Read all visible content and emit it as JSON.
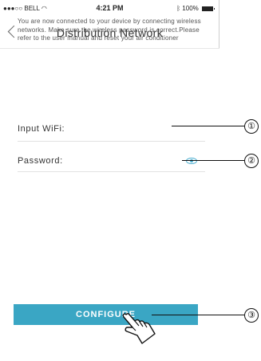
{
  "status_bar": {
    "carrier": "●●●○○ BELL",
    "time": "4:21 PM",
    "battery": "100%"
  },
  "nav": {
    "title": "Distribution Network"
  },
  "intro_text": "You are now connected to your device by connecting wireless networks. Make sure the wireless password is correct.Please refer to the user manual and reset your air conditioner",
  "fields": {
    "wifi_label": "Input WiFi:",
    "password_label": "Password:"
  },
  "configure_label": "CONFIGURE",
  "callouts": [
    "①",
    "②",
    "③"
  ],
  "colors": {
    "accent": "#3aa6c4"
  },
  "icons": {
    "back": "chevron-left-icon",
    "eye": "eye-icon",
    "hand": "hand-pointer-icon",
    "battery": "battery-icon",
    "wifi": "wifi-icon"
  }
}
